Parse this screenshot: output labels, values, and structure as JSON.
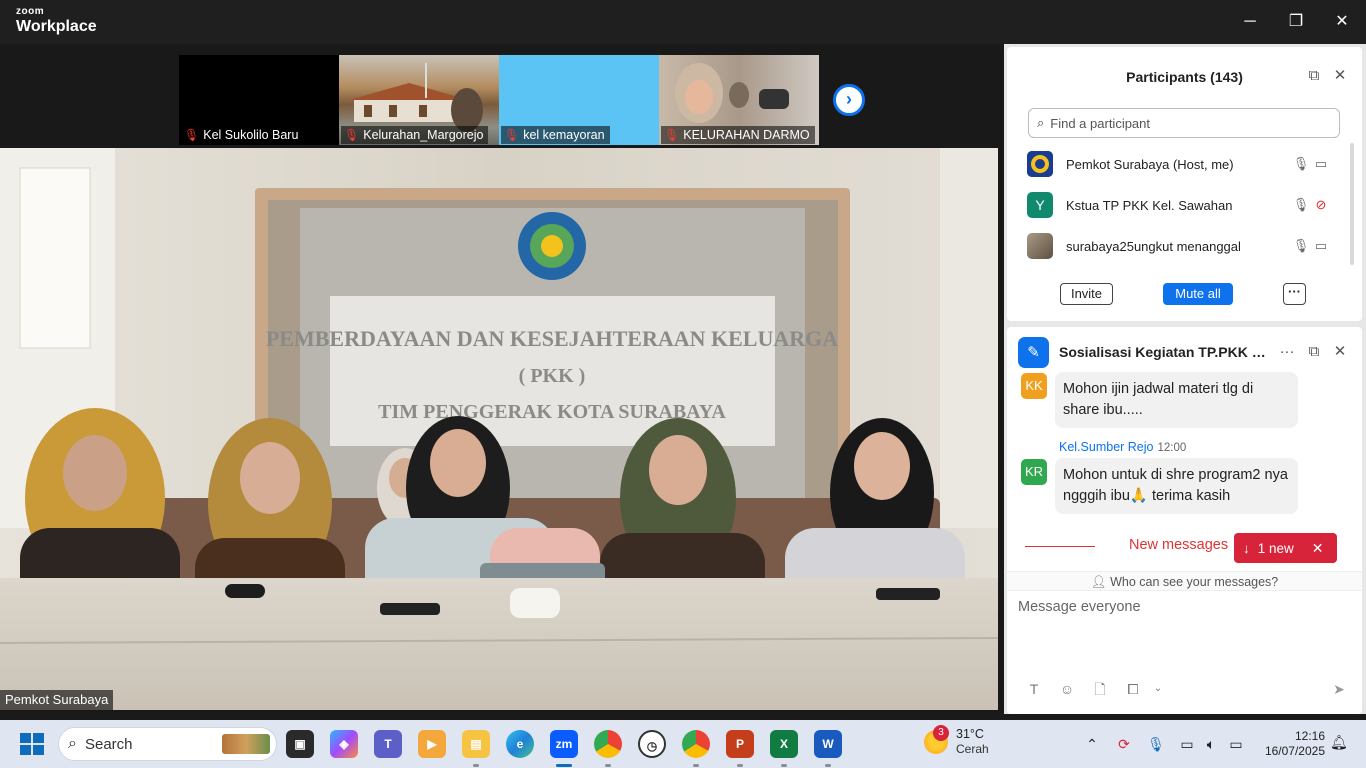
{
  "window": {
    "brand_top": "zoom",
    "brand_bottom": "Workplace",
    "min_glyph": "─",
    "max_glyph": "❐",
    "close_glyph": "✕"
  },
  "video": {
    "thumbnails": [
      {
        "label": "Kel Sukolilo Baru",
        "bg": "#000000",
        "muted": true
      },
      {
        "label": "Kelurahan_Margorejo",
        "bg": "#a9a093",
        "muted": true
      },
      {
        "label": "kel kemayoran",
        "bg": "#5cc3f5",
        "muted": true
      },
      {
        "label": "KELURAHAN DARMO",
        "bg": "#b9a99a",
        "muted": true
      }
    ],
    "next_glyph": "›",
    "active_speaker": "Pemkot Surabaya",
    "banner_line1": "PEMBERDAYAAN DAN KESEJAHTERAAN KELUARGA",
    "banner_line2": "( PKK )",
    "banner_line3": "TIM PENGGERAK KOTA SURABAYA"
  },
  "participants": {
    "title": "Participants (143)",
    "search_placeholder": "Find a participant",
    "rows": [
      {
        "name": "Pemkot Surabaya (Host, me)",
        "avatar_text": "",
        "avatar_color": "#1a3d8f",
        "cam_off": false
      },
      {
        "name": "Kstua TP PKK Kel. Sawahan",
        "avatar_text": "Y",
        "avatar_color": "#10896f",
        "cam_off": true
      },
      {
        "name": "surabaya25ungkut menanggal",
        "avatar_text": "",
        "avatar_color": "#8b7d6b",
        "cam_off": false
      }
    ],
    "invite": "Invite",
    "mute_all": "Mute all",
    "more": "···"
  },
  "chat": {
    "title": "Sosialisasi Kegiatan TP.PKK Kota...",
    "messages": [
      {
        "initials": "KK",
        "avatar_color": "#f0a01e",
        "sender": "",
        "time": "",
        "text": "Mohon ijin jadwal materi tlg di share ibu....."
      },
      {
        "initials": "KR",
        "avatar_color": "#2fa84f",
        "sender": "Kel.Sumber Rejo",
        "time": "12:00",
        "text": "Mohon untuk di shre program2 nya ngggih ibu🙏 terima kasih"
      }
    ],
    "new_messages": "New messages",
    "new_badge": "1 new",
    "visibility": "Who can see your messages?",
    "compose_placeholder": "Message everyone"
  },
  "taskbar": {
    "search_label": "Search",
    "weather_badge": "3",
    "temperature": "31°C",
    "condition": "Cerah",
    "time": "12:16",
    "date": "16/07/2025"
  },
  "colors": {
    "accent": "#0e72ed",
    "alert": "#d8243a"
  }
}
